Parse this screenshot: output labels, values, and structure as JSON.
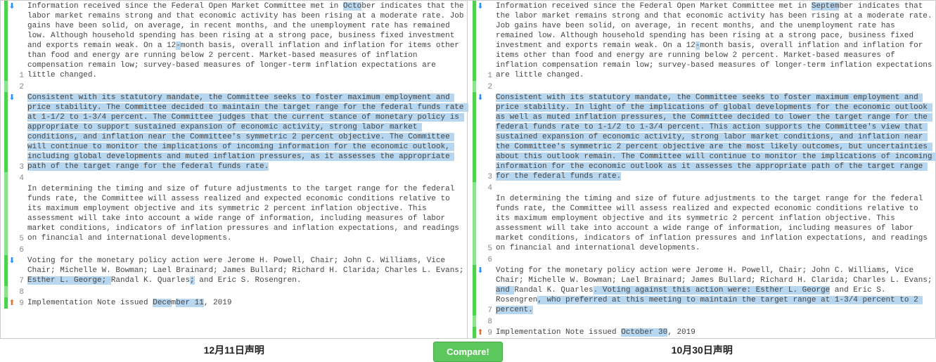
{
  "left": {
    "label": "12月11日声明",
    "rows": [
      {
        "num": "1",
        "arrow": "down",
        "strip": "change",
        "segments": [
          {
            "t": "Information received since the Federal Open Market Committee met in "
          },
          {
            "t": "Octo",
            "hl": true
          },
          {
            "t": "ber indicates that the labor market remains strong and that economic activity has been rising at a moderate rate. Job gains have been solid, on average, in recent months, and the unemployment rate has remained low. Although household spending has been rising at a strong pace, business fixed investment and exports remain weak. On a 12"
          },
          {
            "t": "-",
            "hl": true
          },
          {
            "t": "month basis, overall inflation and inflation for items other than food and energy are running below 2 percent. Market-based measures of inflation compensation remain low; survey-based measures of longer-term inflation expectations are little changed."
          }
        ]
      },
      {
        "num": "2",
        "arrow": "",
        "strip": "same",
        "segments": [
          {
            "t": " "
          }
        ]
      },
      {
        "num": "3",
        "arrow": "down",
        "strip": "change",
        "segments": [
          {
            "t": "Consistent with its statutory mandate, the Committee seeks to foster maximum employment and price stability. The Committee decided to maintain the target range for the federal funds rate at 1-1/2 to 1-3/4 percent. The Committee judges that the current stance of monetary policy is appropriate to support sustained expansion of economic activity, strong labor market conditions, and inflation near the Committee's symmetric 2 percent objective. The Committee will continue to monitor the implications of incoming information for the economic outlook, including global developments and muted inflation pressures, as it assesses the appropriate path of the target range for the federal funds rate.",
            "hl": true
          }
        ]
      },
      {
        "num": "4",
        "arrow": "",
        "strip": "same",
        "segments": [
          {
            "t": " "
          }
        ]
      },
      {
        "num": "5",
        "arrow": "",
        "strip": "same",
        "segments": [
          {
            "t": "In determining the timing and size of future adjustments to the target range for the federal funds rate, the Committee will assess realized and expected economic conditions relative to its maximum employment objective and its symmetric 2 percent inflation objective. This assessment will take into account a wide range of information, including measures of labor market conditions, indicators of inflation pressures and inflation expectations, and readings on financial and international developments."
          }
        ]
      },
      {
        "num": "6",
        "arrow": "",
        "strip": "same",
        "segments": [
          {
            "t": " "
          }
        ]
      },
      {
        "num": "7",
        "arrow": "down",
        "strip": "change",
        "segments": [
          {
            "t": "Voting for the monetary policy action were Jerome H. Powell, Chair; John C. Williams, Vice Chair; Michelle W. Bowman; Lael Brainard; James Bullard; Richard H. Clarida; Charles L. Evans; "
          },
          {
            "t": "Esther L. George; ",
            "hl": true
          },
          {
            "t": "Randal K. Quarles"
          },
          {
            "t": ";",
            "hl": true
          },
          {
            "t": " and Eric S. Rosengren."
          }
        ]
      },
      {
        "num": "8",
        "arrow": "",
        "strip": "same",
        "segments": [
          {
            "t": " "
          }
        ]
      },
      {
        "num": "9",
        "arrow": "up",
        "strip": "change",
        "segments": [
          {
            "t": "Implementation Note issued "
          },
          {
            "t": "Dece",
            "hl": true
          },
          {
            "t": "m"
          },
          {
            "t": "ber 11",
            "hl": true
          },
          {
            "t": ", 2019"
          }
        ]
      }
    ]
  },
  "right": {
    "label": "10月30日声明",
    "rows": [
      {
        "num": "1",
        "arrow": "down",
        "strip": "change",
        "segments": [
          {
            "t": "Information received since the Federal Open Market Committee met in "
          },
          {
            "t": "Septem",
            "hl": true
          },
          {
            "t": "ber indicates that the labor market remains strong and that economic activity has been rising at a moderate rate. Job gains have been solid, on average, in recent months, and the unemployment rate has remained low. Although household spending has been rising at a strong pace, business fixed investment and exports remain weak. On a 12"
          },
          {
            "t": "-",
            "hl": true
          },
          {
            "t": "month basis, overall inflation and inflation for items other than food and energy are running below 2 percent. Market-based measures of inflation compensation remain low; survey-based measures of longer-term inflation expectations are little changed."
          }
        ]
      },
      {
        "num": "2",
        "arrow": "",
        "strip": "same",
        "segments": [
          {
            "t": " "
          }
        ]
      },
      {
        "num": "3",
        "arrow": "down",
        "strip": "change",
        "segments": [
          {
            "t": "Consistent with its statutory mandate, the Committee seeks to foster maximum employment and price stability. In light of the implications of global developments for the economic outlook as well as muted inflation pressures, the Committee decided to lower the target range for the federal funds rate to 1-1/2 to 1-3/4 percent. This action supports the Committee's view that sustained expansion of economic activity, strong labor market conditions, and inflation near the Committee's symmetric 2 percent objective are the most likely outcomes, but uncertainties about this outlook remain. The Committee will continue to monitor the implications of incoming information for the economic outlook as it assesses the appropriate path of the target range for the federal funds rate.",
            "hl": true
          }
        ]
      },
      {
        "num": "4",
        "arrow": "",
        "strip": "same",
        "segments": [
          {
            "t": " "
          }
        ]
      },
      {
        "num": "5",
        "arrow": "",
        "strip": "same",
        "segments": [
          {
            "t": "In determining the timing and size of future adjustments to the target range for the federal funds rate, the Committee will assess realized and expected economic conditions relative to its maximum employment objective and its symmetric 2 percent inflation objective. This assessment will take into account a wide range of information, including measures of labor market conditions, indicators of inflation pressures and inflation expectations, and readings on financial and international developments."
          }
        ]
      },
      {
        "num": "6",
        "arrow": "",
        "strip": "same",
        "segments": [
          {
            "t": " "
          }
        ]
      },
      {
        "num": "7",
        "arrow": "down",
        "strip": "change",
        "segments": [
          {
            "t": "Voting for the monetary policy action were Jerome H. Powell, Chair; John C. Williams, Vice Chair; Michelle W. Bowman; Lael Brainard; James Bullard; Richard H. Clarida; Charles L. Evans; "
          },
          {
            "t": "and ",
            "hl": true
          },
          {
            "t": "Randal K. Quarles"
          },
          {
            "t": ". Voting against this action were: Esther L. George",
            "hl": true
          },
          {
            "t": " and Eric S. Rosengren"
          },
          {
            "t": ", who preferred at this meeting to maintain the target range at 1-3/4 percent to 2 percent.",
            "hl": true
          }
        ]
      },
      {
        "num": "8",
        "arrow": "",
        "strip": "same",
        "segments": [
          {
            "t": " "
          }
        ]
      },
      {
        "num": "9",
        "arrow": "up",
        "strip": "change",
        "segments": [
          {
            "t": "Implementation Note issued "
          },
          {
            "t": "Octo",
            "hl": true
          },
          {
            "t": "ber 30",
            "hl": true
          },
          {
            "t": ", 2019"
          }
        ]
      }
    ]
  },
  "compare_label": "Compare!"
}
